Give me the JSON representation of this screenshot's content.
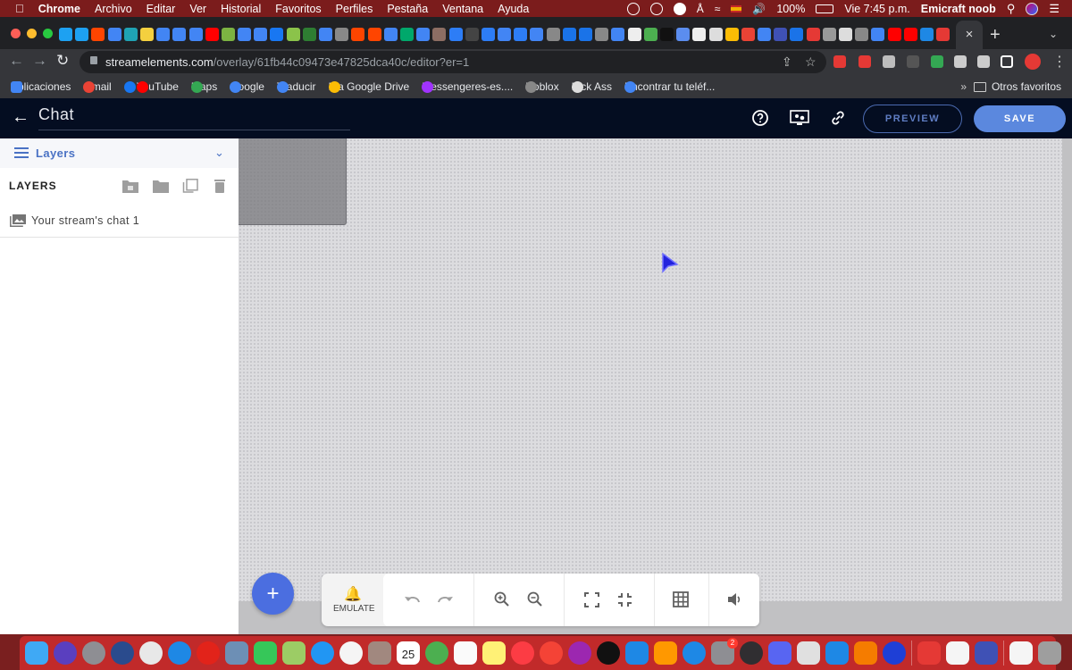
{
  "menubar": {
    "apple": "",
    "items": [
      "Chrome",
      "Archivo",
      "Editar",
      "Ver",
      "Historial",
      "Favoritos",
      "Perfiles",
      "Pestaña",
      "Ventana",
      "Ayuda"
    ],
    "battery": "100%",
    "clock": "Vie 7:45 p.m.",
    "user": "Emicraft noob",
    "status_icons": [
      "creative-cloud-icon",
      "backup-icon",
      "app-icon",
      "bluetooth-icon",
      "wifi-icon",
      "flag-icon",
      "volume-icon",
      "battery-icon",
      "search-icon",
      "siri-icon",
      "control-center-icon"
    ]
  },
  "browser": {
    "tab_close": "×",
    "new_tab": "+",
    "tab_menu": "⌄",
    "favicon_colors": [
      "#1da1f2",
      "#1da1f2",
      "#ff4500",
      "#4285f4",
      "#1fa3b4",
      "#f4d03f",
      "#4285f4",
      "#4285f4",
      "#4285f4",
      "#ff0000",
      "#7cb342",
      "#4285f4",
      "#4285f4",
      "#1877f2",
      "#8bc34a",
      "#2e7d32",
      "#4285f4",
      "#888888",
      "#ff4500",
      "#ff4500",
      "#4285f4",
      "#00a86b",
      "#4285f4",
      "#8d6e63",
      "#2d7df6",
      "#444444",
      "#2d7df6",
      "#4285f4",
      "#2d7df6",
      "#4285f4",
      "#888888",
      "#1a73e8",
      "#1a73e8",
      "#888888",
      "#4285f4",
      "#eeeeee",
      "#4caf50",
      "#111111",
      "#5b8def",
      "#eeeeee",
      "#dddddd",
      "#fbbc05",
      "#ea4335",
      "#4285f4",
      "#3f51b5",
      "#1a73e8",
      "#e53935",
      "#999999",
      "#dddddd",
      "#888888",
      "#4285f4",
      "#ff0000",
      "#ff0000",
      "#1e88e5",
      "#e53935",
      "#ff7043",
      "#3f51b5",
      "#1877f2",
      "#4285f4"
    ],
    "back": "←",
    "forward": "→",
    "reload": "↻",
    "url_host": "streamelements.com",
    "url_path": "/overlay/61fb44c09473e47825dca40c/editor?er=1",
    "share_icon": "⇪",
    "star_icon": "☆",
    "extensions": [
      "#e53935",
      "#e53935",
      "#bdbdbd",
      "#555555",
      "#34a853",
      "#cccccc",
      "#cccccc",
      "#ffffff",
      "#e53935"
    ],
    "menu_icon": "⋮",
    "bookmarks": [
      {
        "label": "Aplicaciones",
        "color": "#4285f4"
      },
      {
        "label": "Gmail",
        "color": "#ea4335"
      },
      {
        "label": "",
        "color": "#1877f2"
      },
      {
        "label": "YouTube",
        "color": "#ff0000"
      },
      {
        "label": "Maps",
        "color": "#34a853"
      },
      {
        "label": "Google",
        "color": "#4285f4"
      },
      {
        "label": "Traducir",
        "color": "#4285f4"
      },
      {
        "label": "Ir a Google Drive",
        "color": "#fbbc05"
      },
      {
        "label": "Messengeres-es....",
        "color": "#a033ff"
      },
      {
        "label": "Roblox",
        "color": "#888888"
      },
      {
        "label": "Kick Ass",
        "color": "#dddddd"
      },
      {
        "label": "Encontrar tu teléf...",
        "color": "#4285f4"
      }
    ],
    "bookmarks_more": "»",
    "other_bookmarks": "Otros favoritos"
  },
  "app": {
    "back_icon": "←",
    "overlay_title": "Chat",
    "header_icons": [
      "help-icon",
      "monitor-settings-icon",
      "link-icon"
    ],
    "preview_label": "PREVIEW",
    "save_label": "SAVE",
    "accent": "#5b88de",
    "header_bg": "#040d21"
  },
  "left_panel": {
    "dropdown_label": "Layers",
    "section_title": "LAYERS",
    "layers": [
      {
        "name": "Your stream's chat 1"
      }
    ]
  },
  "bottom_toolbar": {
    "add_label": "+",
    "emulate_label": "EMULATE"
  },
  "dock": {
    "apps": [
      {
        "name": "finder",
        "color": "#3fa9f5"
      },
      {
        "name": "siri",
        "color": "#5a3fbf"
      },
      {
        "name": "launchpad",
        "color": "#8e8e93"
      },
      {
        "name": "quicktime",
        "color": "#2a4b8d"
      },
      {
        "name": "chrome",
        "color": "#e8e8e8"
      },
      {
        "name": "safari",
        "color": "#1e88e5"
      },
      {
        "name": "opera",
        "color": "#e2231a"
      },
      {
        "name": "preview",
        "color": "#6d8fb5"
      },
      {
        "name": "facetime",
        "color": "#36c759"
      },
      {
        "name": "maps",
        "color": "#9ccc65"
      },
      {
        "name": "messages",
        "color": "#2196f3"
      },
      {
        "name": "photos",
        "color": "#f5f5f5"
      },
      {
        "name": "contacts",
        "color": "#a1887f"
      },
      {
        "name": "calendar",
        "color": "#ffffff",
        "text": "25"
      },
      {
        "name": "find-my",
        "color": "#4caf50"
      },
      {
        "name": "reminders",
        "color": "#fafafa"
      },
      {
        "name": "notes",
        "color": "#fff176"
      },
      {
        "name": "music",
        "color": "#fc3c44"
      },
      {
        "name": "news",
        "color": "#f44336"
      },
      {
        "name": "podcasts",
        "color": "#9c27b0"
      },
      {
        "name": "tv",
        "color": "#111111"
      },
      {
        "name": "keynote",
        "color": "#1e88e5"
      },
      {
        "name": "pages",
        "color": "#ff9800"
      },
      {
        "name": "app-store",
        "color": "#1e88e5"
      },
      {
        "name": "system-preferences",
        "color": "#8e8e93",
        "badge": "2"
      },
      {
        "name": "obs",
        "color": "#302e31"
      },
      {
        "name": "discord",
        "color": "#5865f2"
      },
      {
        "name": "roblox",
        "color": "#e0e0e0"
      },
      {
        "name": "roblox-studio",
        "color": "#1e88e5"
      },
      {
        "name": "blender",
        "color": "#f57c00"
      },
      {
        "name": "omega",
        "color": "#1e3fd6"
      },
      {
        "name": "streamlabs",
        "color": "#e53935"
      },
      {
        "name": "textedit",
        "color": "#f5f5f5"
      },
      {
        "name": "virtualbox",
        "color": "#3f51b5"
      },
      {
        "name": "document",
        "color": "#f5f5f5"
      },
      {
        "name": "trash",
        "color": "#9e9e9e"
      }
    ]
  }
}
